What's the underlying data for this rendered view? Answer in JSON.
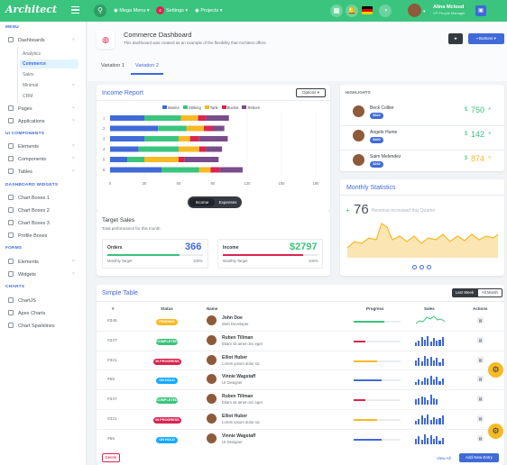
{
  "app": {
    "logo": "Architect"
  },
  "topbar": {
    "menu_items": [
      "Mega Menu",
      "Settings",
      "Projects"
    ],
    "settings_badge": "4",
    "user_name": "Alina Mcloud",
    "user_title": "VP People Manager"
  },
  "sidebar": {
    "menu_heading": "MENU",
    "dashboards": "Dashboards",
    "dash_subs": [
      "Analytics",
      "Commerce",
      "Sales",
      "Minimal",
      "CRM"
    ],
    "items1": [
      "Pages",
      "Applications"
    ],
    "ui_heading": "UI COMPONENTS",
    "ui_items": [
      "Elements",
      "Components",
      "Tables"
    ],
    "dw_heading": "DASHBOARD WIDGETS",
    "dw_items": [
      "Chart Boxes 1",
      "Chart Boxes 2",
      "Chart Boxes 3",
      "Profile Boxes"
    ],
    "forms_heading": "FORMS",
    "forms_items": [
      "Elements",
      "Widgets"
    ],
    "charts_heading": "CHARTS",
    "charts_items": [
      "ChartJS",
      "Apex Charts",
      "Chart Sparklines"
    ]
  },
  "page": {
    "title": "Commerce Dashboard",
    "subtitle": "This dashboard was created as an example of the flexibility that Architect offers.",
    "buttons_label": "Buttons",
    "star": "★"
  },
  "tabs": [
    "Variation 1",
    "Variation 2"
  ],
  "income": {
    "title": "Income Report",
    "options": "Options",
    "legend": [
      "Marine",
      "Striking",
      "Tank",
      "Bucket",
      "Reborn"
    ],
    "legend_colors": [
      "#3f6ad8",
      "#3ac47d",
      "#f7b924",
      "#d92550",
      "#794c8a"
    ],
    "toggle": [
      "Income",
      "Expenses"
    ],
    "rows": [
      {
        "label": "1",
        "values": [
          30,
          32,
          15,
          7,
          20
        ]
      },
      {
        "label": "2",
        "values": [
          42,
          25,
          15,
          8,
          10
        ]
      },
      {
        "label": "3",
        "values": [
          30,
          30,
          10,
          8,
          25
        ]
      },
      {
        "label": "4",
        "values": [
          25,
          35,
          18,
          6,
          14
        ]
      },
      {
        "label": "5",
        "values": [
          15,
          15,
          30,
          5,
          30
        ]
      },
      {
        "label": "6",
        "values": [
          45,
          33,
          10,
          8,
          20
        ]
      }
    ],
    "xticks": [
      "0",
      "30",
      "60",
      "90",
      "120",
      "150",
      "180"
    ]
  },
  "target": {
    "title": "Target Sales",
    "subtitle": "Total performance for this month",
    "orders_label": "Orders",
    "orders_value": "366",
    "orders_target": "Monthly Target",
    "orders_pct": "100%",
    "income_label": "Income",
    "income_value": "$2797",
    "income_target": "Monthly Target",
    "income_pct": "100%"
  },
  "highlights": {
    "title": "HIGHLIGHTS",
    "people": [
      {
        "name": "Beck Collier",
        "badge": "$322",
        "value": "750",
        "dir": "up"
      },
      {
        "name": "Angelo Hume",
        "badge": "$400",
        "value": "142",
        "dir": "up"
      },
      {
        "name": "Saim Melendez",
        "badge": "$242",
        "value": "874",
        "dir": "down"
      }
    ]
  },
  "monthly": {
    "title": "Monthly Statistics",
    "value": "76",
    "text": "Revenue increased this Quarter",
    "sign": "+"
  },
  "table": {
    "title": "Simple Table",
    "toggle": [
      "Last Week",
      "All Month"
    ],
    "headers": [
      "#",
      "Status",
      "Name",
      "Progress",
      "Sales",
      "Actions"
    ],
    "rows": [
      {
        "id": "#345",
        "status": "PENDING",
        "name": "John Doe",
        "role": "Web Developer",
        "pcolor": "#3ac47d",
        "pval": 0.65
      },
      {
        "id": "#347",
        "status": "COMPLETED",
        "name": "Ruben Tillman",
        "role": "Etiam sit amet orci eget",
        "pcolor": "#d92550",
        "pval": 0.25
      },
      {
        "id": "#321",
        "status": "IN PROGRESS",
        "name": "Elliot Huber",
        "role": "Lorem ipsum dolor sic",
        "pcolor": "#f7b924",
        "pval": 0.5
      },
      {
        "id": "#55",
        "status": "ON HOLD",
        "name": "Vinnie Wagstaff",
        "role": "UI Designer",
        "pcolor": "#3f6ad8",
        "pval": 0.6
      },
      {
        "id": "#347",
        "status": "COMPLETED",
        "name": "Ruben Tillman",
        "role": "Etiam sit amet orci eget",
        "pcolor": "#d92550",
        "pval": 0.25
      },
      {
        "id": "#321",
        "status": "IN PROGRESS",
        "name": "Elliot Huber",
        "role": "Lorem ipsum dolor sic",
        "pcolor": "#f7b924",
        "pval": 0.5
      },
      {
        "id": "#55",
        "status": "ON HOLD",
        "name": "Vinnie Wagstaff",
        "role": "UI Designer",
        "pcolor": "#3f6ad8",
        "pval": 0.6
      }
    ],
    "status_colors": {
      "PENDING": "#f7b924",
      "COMPLETED": "#3ac47d",
      "IN PROGRESS": "#d92550",
      "ON HOLD": "#16aaff"
    },
    "delete": "Delete",
    "view_all": "View All",
    "add_new": "Add New Entry"
  }
}
